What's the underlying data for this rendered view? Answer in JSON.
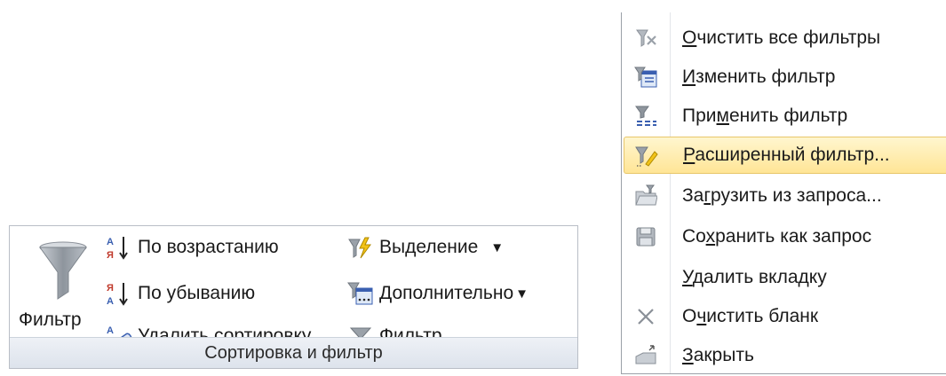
{
  "ribbon": {
    "group_label": "Сортировка и фильтр",
    "filter_big_label": "Фильтр",
    "ascending_label": "По возрастанию",
    "descending_label": "По убыванию",
    "remove_sort_label": "Удалить сортировку",
    "selection_label": "Выделение",
    "advanced_label": "Дополнительно",
    "toggle_filter_label": "Фильтр",
    "dropdown_arrow": "▼"
  },
  "menu": {
    "items": [
      {
        "pre": "",
        "u": "О",
        "post": "чистить все фильтры",
        "icon": "clear-all-filters-icon"
      },
      {
        "pre": "",
        "u": "И",
        "post": "зменить фильтр",
        "icon": "edit-filter-icon"
      },
      {
        "pre": "При",
        "u": "м",
        "post": "енить фильтр",
        "icon": "apply-filter-icon"
      },
      {
        "pre": "",
        "u": "Р",
        "post": "асширенный фильтр...",
        "icon": "advanced-filter-icon"
      },
      {
        "pre": "За",
        "u": "г",
        "post": "рузить из запроса...",
        "icon": "load-from-query-icon"
      },
      {
        "pre": "Со",
        "u": "х",
        "post": "ранить как запрос",
        "icon": "save-as-query-icon"
      },
      {
        "pre": "",
        "u": "У",
        "post": "далить вкладку",
        "icon": ""
      },
      {
        "pre": "О",
        "u": "ч",
        "post": "истить бланк",
        "icon": "clear-grid-icon"
      },
      {
        "pre": "",
        "u": "З",
        "post": "акрыть",
        "icon": "close-icon"
      }
    ],
    "highlighted_index": 3
  },
  "colors": {
    "highlight_top": "#fff6cf",
    "highlight_bottom": "#ffe596",
    "funnel": "#9aa1a9",
    "accent_blue": "#3a5fb0",
    "accent_red": "#c0392b"
  }
}
